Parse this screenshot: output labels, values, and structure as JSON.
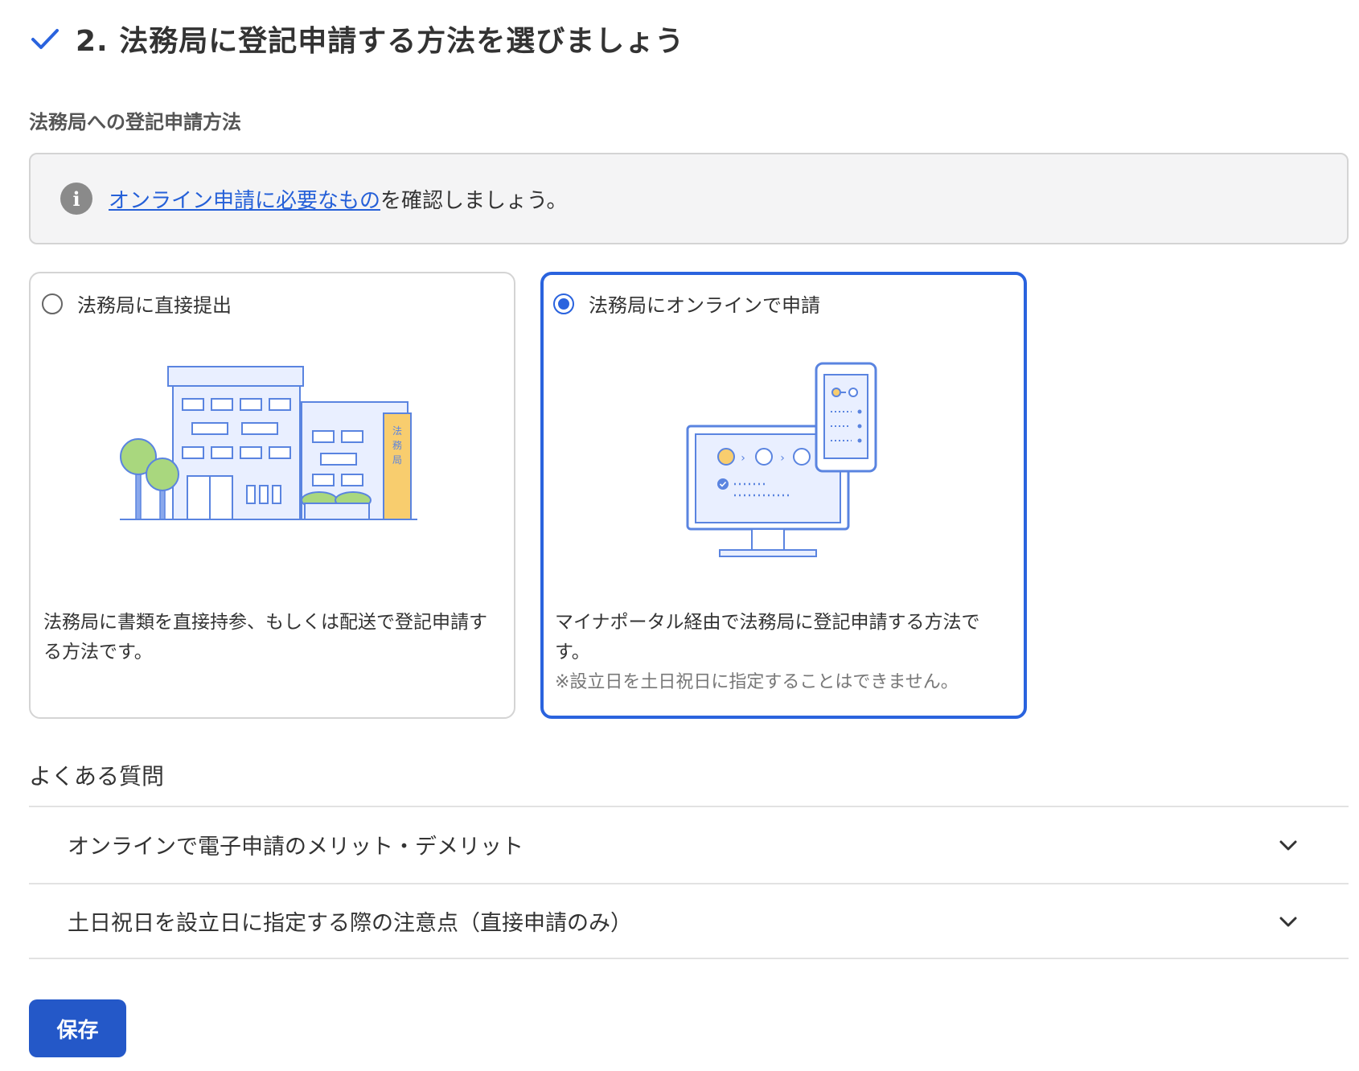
{
  "header": {
    "title": "2. 法務局に登記申請する方法を選びましょう"
  },
  "section": {
    "label": "法務局への登記申請方法"
  },
  "info": {
    "link_text": "オンライン申請に必要なもの",
    "text_after": "を確認しましょう。"
  },
  "options": [
    {
      "title": "法務局に直接提出",
      "selected": false,
      "illustration_label": "法務局",
      "description": "法務局に書類を直接持参、もしくは配送で登記申請する方法です。",
      "note": ""
    },
    {
      "title": "法務局にオンラインで申請",
      "selected": true,
      "description": "マイナポータル経由で法務局に登記申請する方法です。",
      "note": "※設立日を土日祝日に指定することはできません。"
    }
  ],
  "faq": {
    "heading": "よくある質問",
    "items": [
      {
        "question": "オンラインで電子申請のメリット・デメリット"
      },
      {
        "question": "土日祝日を設立日に指定する際の注意点（直接申請のみ）"
      }
    ]
  },
  "save": {
    "label": "保存"
  },
  "colors": {
    "accent": "#2a63de",
    "button": "#2458c8",
    "illus_blue": "#5a84e0",
    "illus_fill": "#e9efff",
    "illus_orange": "#f8cd6e",
    "illus_green": "#a9d77e"
  }
}
